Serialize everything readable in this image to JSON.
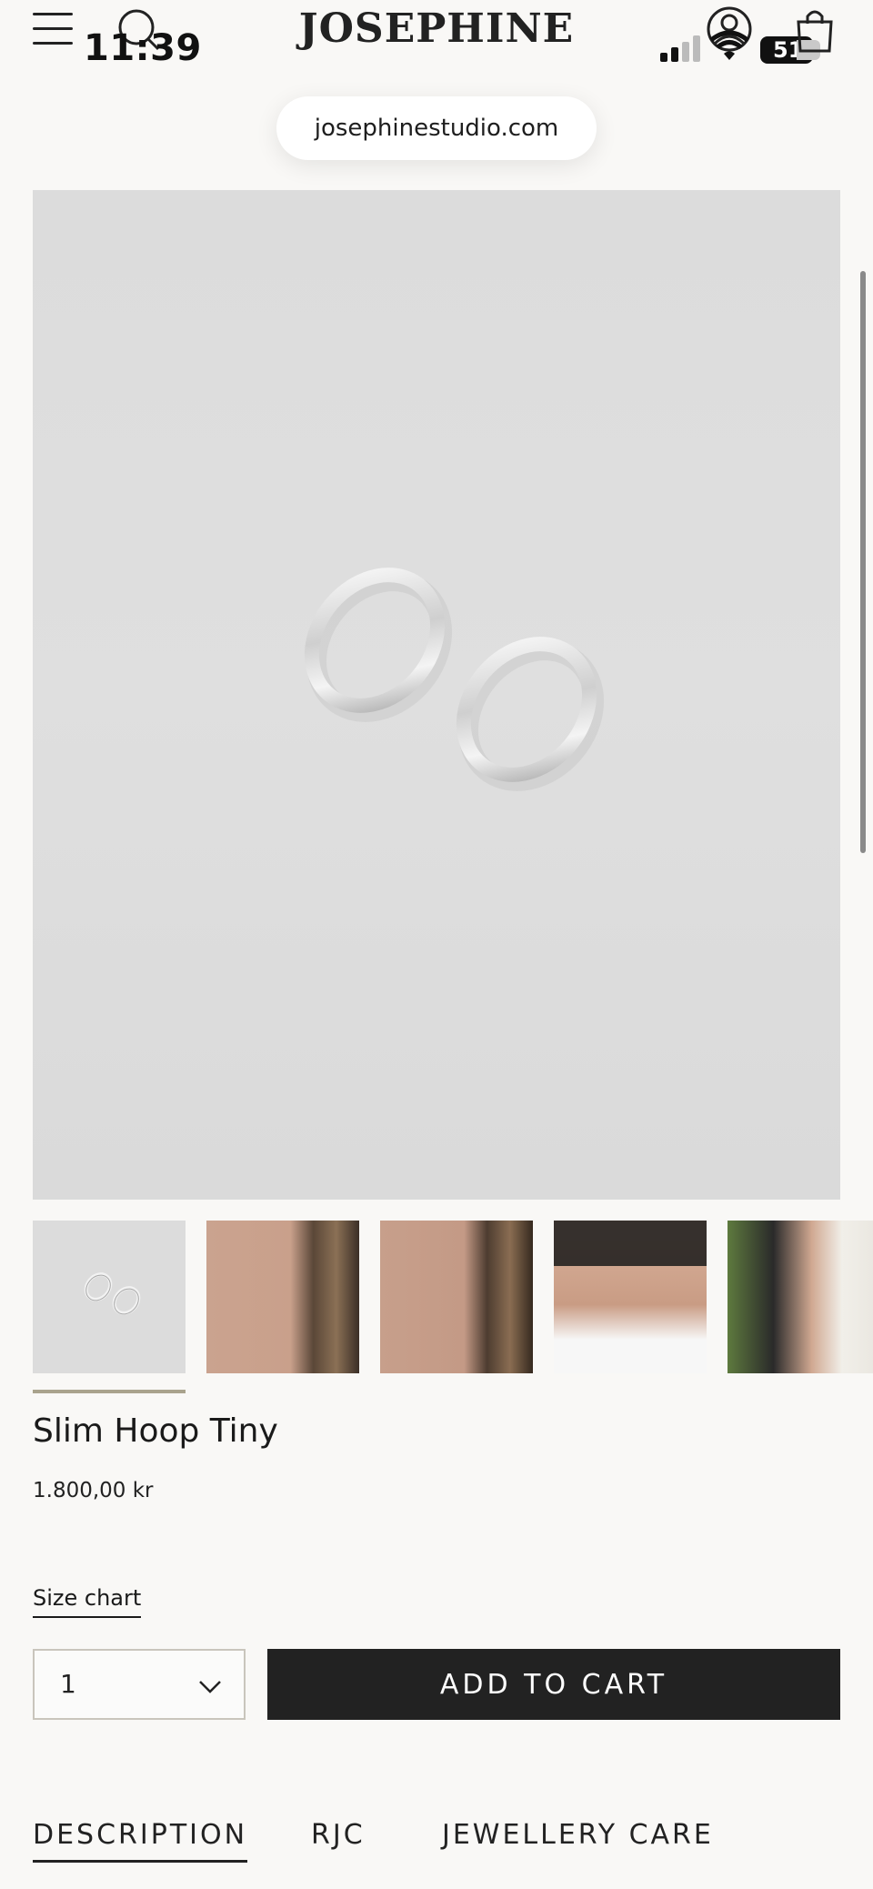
{
  "status": {
    "time": "11:39",
    "battery": "51"
  },
  "header": {
    "logo": "JOSEPHINE",
    "url": "josephinestudio.com"
  },
  "product": {
    "title": "Slim Hoop Tiny",
    "price": "1.800,00 kr",
    "size_chart_label": "Size chart",
    "quantity": "1",
    "add_to_cart_label": "ADD TO CART"
  },
  "tabs": [
    {
      "label": "DESCRIPTION",
      "active": true
    },
    {
      "label": "RJC",
      "active": false
    },
    {
      "label": "JEWELLERY CARE",
      "active": false
    }
  ],
  "icons": [
    "menu-icon",
    "search-icon",
    "account-icon",
    "bag-icon",
    "chevron-down-icon"
  ],
  "colors": {
    "accent": "#a9a38d",
    "button": "#222222",
    "background": "#f9f8f6"
  }
}
